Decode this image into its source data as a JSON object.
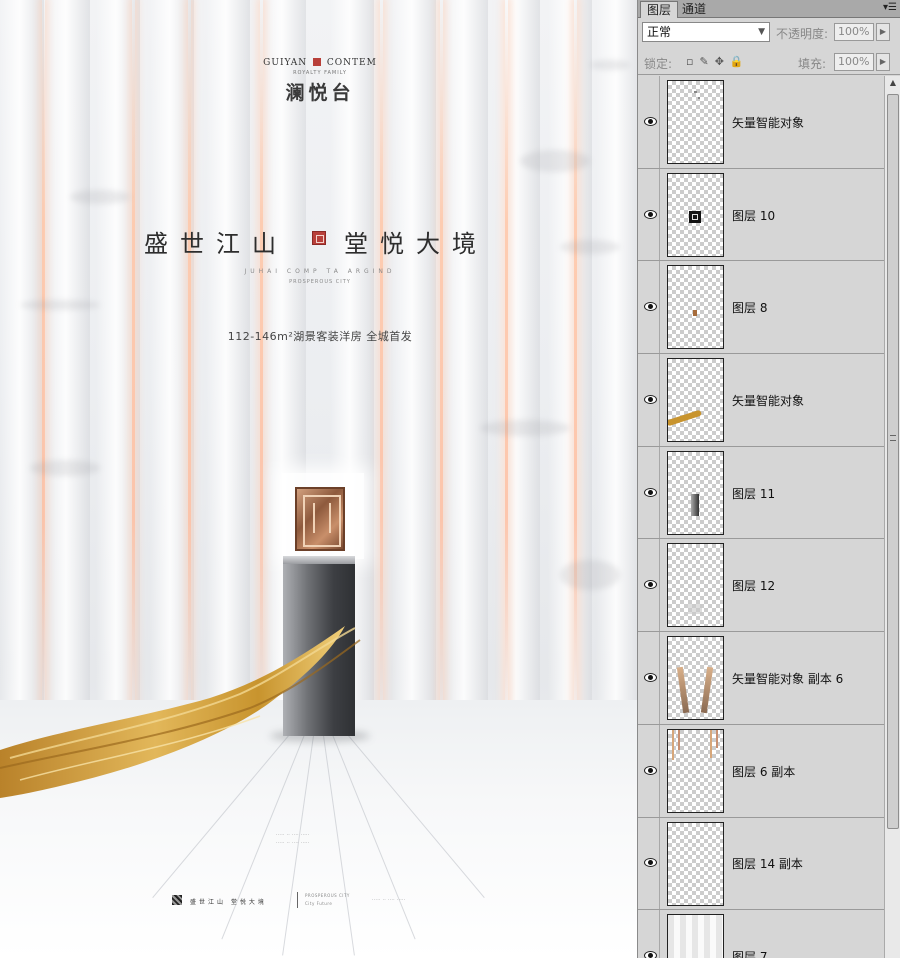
{
  "poster": {
    "brand_en_left": "GUIYAN",
    "brand_en_right": "CONTEM",
    "brand_sub": "ROYALTY FAMILY",
    "brand_cn": "澜悦台",
    "headline_left": "盛世江山",
    "headline_right": "堂悦大境",
    "subtitle_en": "JUHAI COMP TA ARGIND",
    "subtitle_en2": "PROSPEROUS CITY",
    "tagline": "112-146m²湖景客装洋房 全城首发",
    "footer_cn": "盛世江山 堂悦大境",
    "footer_en_a": "PROSPEROUS CITY",
    "footer_en_b": "City Future",
    "footer_tiny": "·····  ·· ···· ·····"
  },
  "panel": {
    "tabs": [
      {
        "label": "图层",
        "active": true
      },
      {
        "label": "通道",
        "active": false
      }
    ],
    "menu_icon": "panel-menu-icon",
    "blend_mode": "正常",
    "opacity_label": "不透明度:",
    "opacity_value": "100%",
    "lock_label": "锁定:",
    "fill_label": "填充:",
    "fill_value": "100%",
    "layers": [
      {
        "name": "矢量智能对象",
        "visible": true,
        "thumb": "dots"
      },
      {
        "name": "图层 10",
        "visible": true,
        "thumb": "square"
      },
      {
        "name": "图层 8",
        "visible": true,
        "thumb": "small-gold"
      },
      {
        "name": "矢量智能对象",
        "visible": true,
        "thumb": "gold-stroke"
      },
      {
        "name": "图层 11",
        "visible": true,
        "thumb": "column"
      },
      {
        "name": "图层 12",
        "visible": true,
        "thumb": "faint"
      },
      {
        "name": "矢量智能对象 副本 6",
        "visible": true,
        "thumb": "two-bars"
      },
      {
        "name": "图层 6 副本",
        "visible": true,
        "thumb": "drips"
      },
      {
        "name": "图层 14 副本",
        "visible": true,
        "thumb": "blank"
      },
      {
        "name": "图层 7",
        "visible": true,
        "thumb": "curtain"
      }
    ]
  },
  "colors": {
    "seal_red": "#b8403a",
    "gold": "#c8942e",
    "panel_bg": "#d6d6d6"
  }
}
